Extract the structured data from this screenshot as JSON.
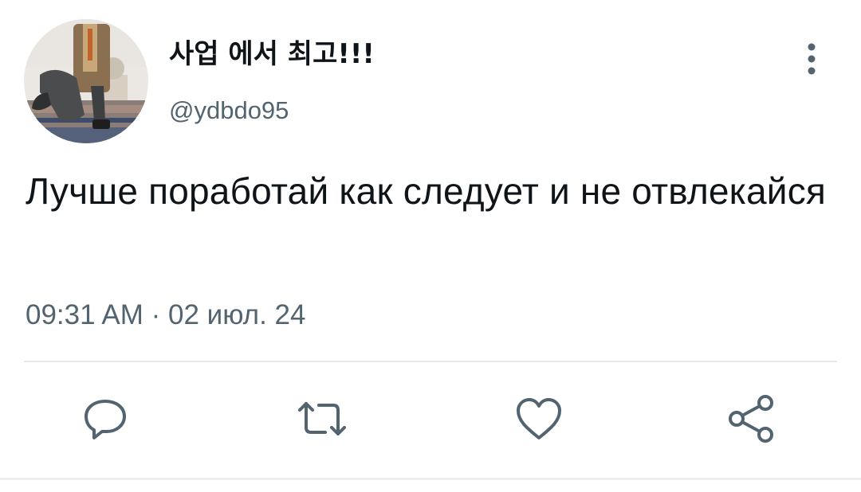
{
  "tweet": {
    "display_name": "사업 에서 최고!!!",
    "handle": "@ydbdo95",
    "text": "Лучше поработай как следует и не отвлекайся",
    "timestamp": "09:31 AM · 02 июл. 24"
  },
  "icons": {
    "more": "more-vertical-icon",
    "reply": "reply-icon",
    "retweet": "retweet-icon",
    "like": "heart-icon",
    "share": "share-icon"
  },
  "colors": {
    "text": "#0f1419",
    "secondary": "#536471",
    "icon": "#536471",
    "divider": "#e6e9ec"
  }
}
